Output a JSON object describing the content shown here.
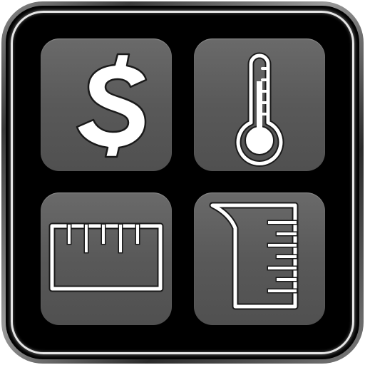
{
  "app_icon": {
    "icons": [
      "dollar-sign-icon",
      "thermometer-icon",
      "ruler-icon",
      "measuring-cup-icon"
    ],
    "colors": {
      "tile": "#5c5c5c",
      "background": "#000000",
      "symbol": "#ffffff",
      "frame": "#e6e6e6"
    }
  }
}
